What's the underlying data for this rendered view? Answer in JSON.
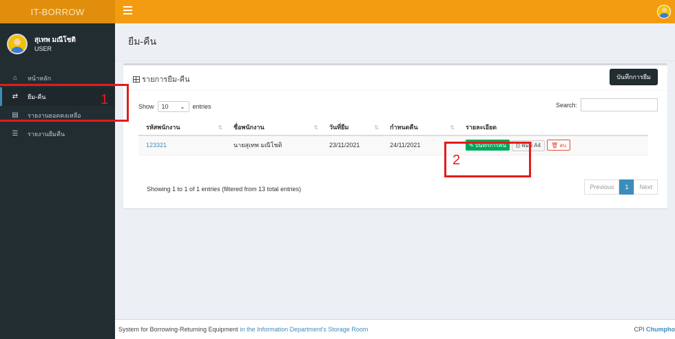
{
  "app": {
    "logo": "IT-BORROW"
  },
  "user": {
    "name": "สุเทพ มณีโชติ",
    "role": "USER"
  },
  "sidebar": {
    "items": [
      {
        "label": "หน้าหลัก",
        "icon": "home-icon"
      },
      {
        "label": "ยืม-คืน",
        "icon": "shuffle-icon",
        "active": true
      },
      {
        "label": "รายงานยอดคงเหลือ",
        "icon": "report-icon"
      },
      {
        "label": "รายงานยืมคืน",
        "icon": "list-icon"
      }
    ]
  },
  "page": {
    "title": "ยืม-คืน"
  },
  "box": {
    "title": "รายการยืม-คืน",
    "save_borrow_label": "บันทึกการยืม",
    "show_label": "Show",
    "length_value": "10",
    "entries_label": "entries",
    "search_label": "Search:",
    "search_value": ""
  },
  "table": {
    "columns": [
      "รหัสพนักงาน",
      "ชื่อพนักงาน",
      "วันที่ยืม",
      "กำหนดคืน",
      "รายละเอียด"
    ],
    "rows": [
      {
        "emp_id": "123321",
        "emp_name": "นายสุเทพ มณีโชติ",
        "borrow_date": "23/11/2021",
        "due_date": "24/11/2021"
      }
    ],
    "actions": {
      "return_label": "บันทึกการคืน",
      "print_label": "พิมพ์ A4",
      "delete_label": "ลบ"
    }
  },
  "pagination": {
    "info": "Showing 1 to 1 of 1 entries (filtered from 13 total entries)",
    "previous": "Previous",
    "current": "1",
    "next": "Next"
  },
  "footer": {
    "text": "System for Borrowing-Returning Equipment",
    "highlight": "in the Information Department's Storage Room",
    "right_prefix": "CPI",
    "right_bold": "Chumpho"
  },
  "annotations": {
    "step1": "1",
    "step2": "2",
    "color": "#e21b1b"
  },
  "colors": {
    "navbar": "#f39c12",
    "logo": "#e08e0b",
    "sidebar": "#222d32",
    "accent": "#3c8dbc",
    "success": "#00a65a"
  }
}
